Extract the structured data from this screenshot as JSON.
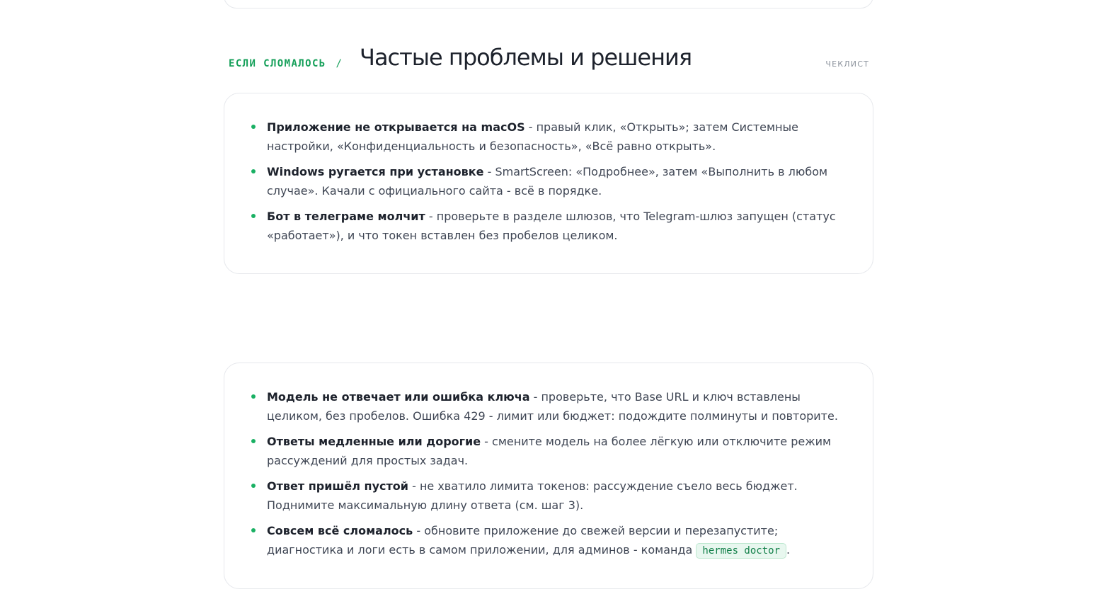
{
  "section": {
    "eyebrow": "ЕСЛИ СЛОМАЛОСЬ",
    "eyebrow_separator": "/",
    "title": "Частые проблемы и решения",
    "tag": "ЧЕКЛИСТ"
  },
  "card1": {
    "items": [
      {
        "title": "Приложение не открывается на macOS",
        "text": " - правый клик, «Открыть»; затем Системные настройки, «Конфиденциальность и безопасность», «Всё равно открыть»."
      },
      {
        "title": "Windows ругается при установке",
        "text": " - SmartScreen: «Подробнее», затем «Выполнить в любом случае». Качали с официального сайта - всё в порядке."
      },
      {
        "title": "Бот в телеграме молчит",
        "text": " - проверьте в разделе шлюзов, что Telegram-шлюз запущен (статус «работает»), и что токен вставлен без пробелов целиком."
      }
    ]
  },
  "card2": {
    "items": [
      {
        "title": "Модель не отвечает или ошибка ключа",
        "text": " - проверьте, что Base URL и ключ вставлены целиком, без пробелов. Ошибка 429 - лимит или бюджет: подождите полминуты и повторите."
      },
      {
        "title": "Ответы медленные или дорогие",
        "text": " - смените модель на более лёгкую или отключите режим рассуждений для простых задач."
      },
      {
        "title": "Ответ пришёл пустой",
        "text": " - не хватило лимита токенов: рассуждение съело весь бюджет. Поднимите максимальную длину ответа (см. шаг 3)."
      },
      {
        "title": "Совсем всё сломалось",
        "text": " - обновите приложение до свежей версии и перезапустите; диагностика и логи есть в самом приложении, для админов - команда ",
        "code": "hermes doctor",
        "after": "."
      }
    ]
  }
}
